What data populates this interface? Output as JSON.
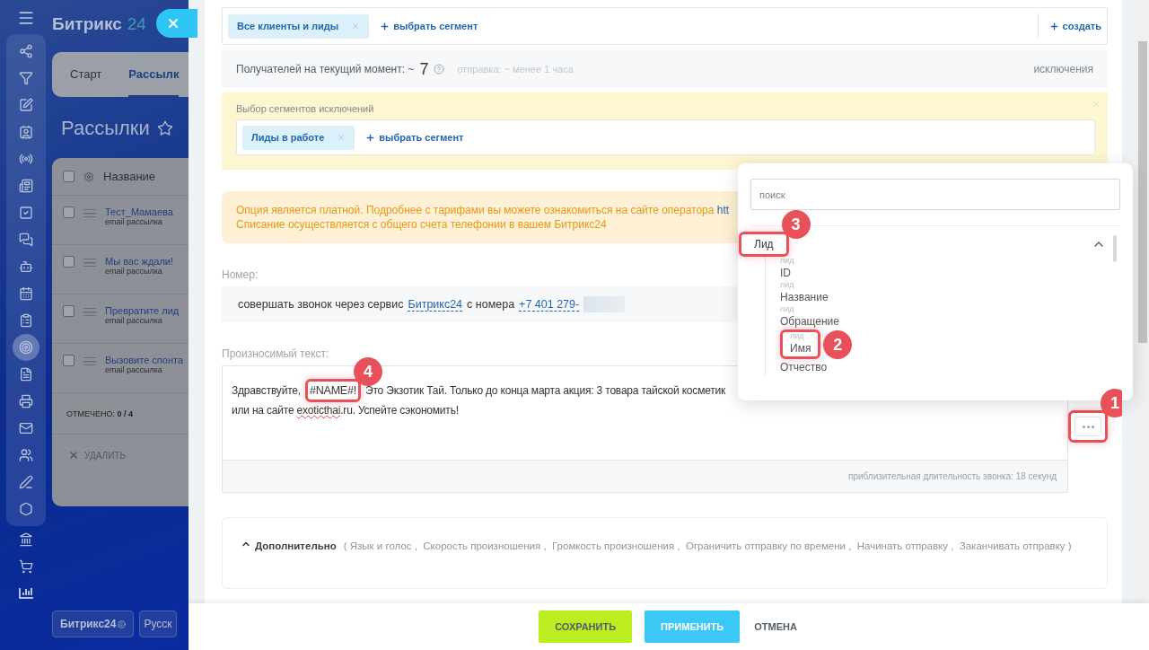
{
  "left_page": {
    "brand": "Битрикс",
    "brand_number": "24",
    "menu": [
      {
        "selected": false
      },
      {
        "selected": false
      },
      {
        "selected": false
      },
      {
        "selected": false
      },
      {
        "selected": false
      },
      {
        "selected": false
      },
      {
        "selected": false
      },
      {
        "selected": false
      },
      {
        "selected": false
      },
      {
        "selected": false
      },
      {
        "selected": false
      },
      {
        "selected": true
      },
      {
        "selected": false
      },
      {
        "selected": false
      },
      {
        "selected": false
      },
      {
        "selected": false
      },
      {
        "selected": false
      },
      {
        "selected": false
      },
      {
        "selected": false
      },
      {
        "selected": false
      },
      {
        "selected": false
      }
    ],
    "tabs": [
      {
        "label": "Старт",
        "selected": false
      },
      {
        "label": "Рассылк",
        "selected": true
      }
    ],
    "title": "Рассылки",
    "grid": {
      "column": "Название",
      "all_checked": false,
      "rows": [
        {
          "title": "Тест_Мамаева",
          "subtitle": "email рассылка",
          "checked": false
        },
        {
          "title": "Мы вас ждали!",
          "subtitle": "email рассылка",
          "checked": false
        },
        {
          "title": "Превратите лид",
          "subtitle": "email рассылка",
          "checked": false
        },
        {
          "title": "Вызовите спонта",
          "subtitle": "email рассылка",
          "checked": false
        }
      ],
      "selected_label": "ОТМЕЧЕНО:",
      "selected_count": "0 / 4",
      "delete": "УДАЛИТЬ"
    },
    "footer_buttons": [
      {
        "label": "Битрикс24",
        "kind": "logo"
      },
      {
        "label": "Русск",
        "kind": "language"
      }
    ]
  },
  "recipients": {
    "segments": [
      {
        "label": "Все клиенты и лиды"
      }
    ],
    "add_segment": "выбрать сегмент",
    "create": "создать",
    "count_label": "Получателей на текущий момент: ~",
    "count": "7",
    "sending": "отправка: ~ менее 1 часа",
    "exclusions_link": "исключения"
  },
  "exclusions": {
    "label": "Выбор сегментов исключений",
    "segments": [
      {
        "label": "Лиды в работе"
      }
    ],
    "add_segment": "выбрать сегмент"
  },
  "notice": {
    "line1": "Опция является платной. Подробнее с тарифами вы можете ознакомиться на сайте оператора",
    "link": "htt",
    "line2": "Списание осуществляется с общего счета телефонии в вашем Битрикс24"
  },
  "number": {
    "label": "Номер:",
    "prefix": "совершать звонок через сервис",
    "service": "Битрикс24",
    "middle": "с номера",
    "phone": "+7 401 279-"
  },
  "speech": {
    "label": "Произносимый текст:",
    "before": "Здравствуйте,",
    "variable": "#NAME#!",
    "variable_callout": "4",
    "after": "Это Экзотик Тай. Только до конца марта акция: 3 товара тайской косметик",
    "line2_before": "или на сайте",
    "misspelled": "exoticthai",
    "line2_after": ".ru. Успейте сэкономить!",
    "duration": "приблизительная длительность звонка: 18 секунд",
    "menu_callout": "1"
  },
  "field_picker": {
    "search_placeholder": "поиск",
    "groups": [
      {
        "label": "Лид",
        "expanded": true,
        "callout": "3",
        "items": [
          {
            "caption": "лид",
            "label": "ID"
          },
          {
            "caption": "лид",
            "label": "Название"
          },
          {
            "caption": "лид",
            "label": "Обращение"
          },
          {
            "caption": "лид",
            "label": "Имя",
            "callout": "2"
          },
          {
            "label": "Отчество"
          }
        ]
      }
    ]
  },
  "advanced": {
    "title": "Дополнительно",
    "expanded": true,
    "options": "( Язык и голос ,  Скорость произношения ,  Громкость произношения ,  Ограничить отправку по времени ,  Начинать отправку ,  Заканчивать отправку )"
  },
  "footer": {
    "buttons": [
      {
        "label": "СОХРАНИТЬ",
        "kind": "save"
      },
      {
        "label": "ПРИМЕНИТЬ",
        "kind": "apply"
      },
      {
        "label": "ОТМЕНА",
        "kind": "cancel"
      }
    ]
  }
}
